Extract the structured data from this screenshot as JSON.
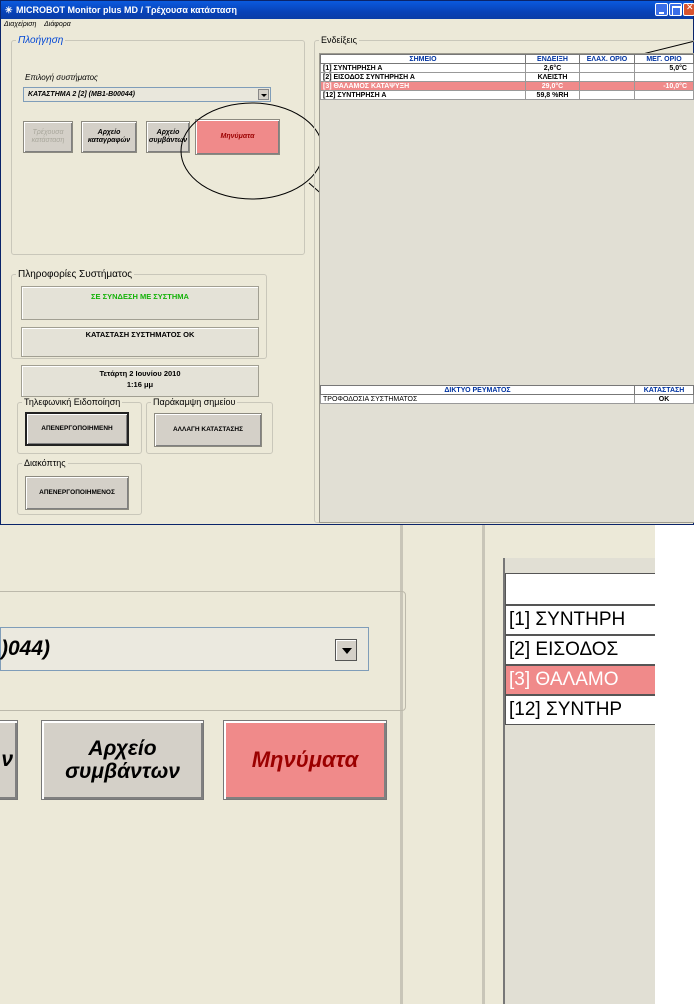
{
  "window": {
    "title": "MICROBOT Monitor plus MD / Τρέχουσα κατάσταση",
    "menu": [
      "Διαχείριση",
      "Διάφορα"
    ]
  },
  "navigation": {
    "legend": "Πλοήγηση",
    "system_label": "Επιλογή συστήματος",
    "system_value": "ΚΑΤΑΣΤΗΜΑ 2 [2] (MB1-B00044)",
    "btn_current": "Τρέχουσα κατάσταση",
    "btn_log": "Αρχείο καταγραφών",
    "btn_events": "Αρχείο συμβάντων",
    "btn_messages": "Μηνύματα"
  },
  "system_info": {
    "legend": "Πληροφορίες Συστήματος",
    "connection": "ΣΕ ΣΥΝΔΕΣΗ ΜΕ ΣΥΣΤΗΜΑ",
    "status": "ΚΑΤΑΣΤΑΣΗ ΣΥΣΤΗΜΑΤΟΣ ΟΚ",
    "date": "Τετάρτη 2 Ιουνίου 2010",
    "time": "1:16 μμ"
  },
  "phone": {
    "legend": "Τηλεφωνική Ειδοποίηση",
    "button": "ΑΠΕΝΕΡΓΟΠΟΙΗΜΕΝΗ"
  },
  "override": {
    "legend": "Παράκαμψη σημείου",
    "button": "ΑΛΛΑΓΗ ΚΑΤΑΣΤΑΣΗΣ"
  },
  "switch": {
    "legend": "Διακόπτης",
    "button": "ΑΠΕΝΕΡΓΟΠΟΙΗΜΕΝΟΣ"
  },
  "indications": {
    "legend": "Ενδείξεις",
    "headers": [
      "ΣΗΜΕΙΟ",
      "ΕΝΔΕΙΞΗ",
      "ΕΛΑΧ. ΟΡΙΟ",
      "ΜΕΓ. ΟΡΙΟ"
    ],
    "rows": [
      {
        "point": "[1] ΣΥΝΤΗΡΗΣΗ Α",
        "value": "2,6°C",
        "min": "",
        "max": "5,0°C",
        "alarm": false
      },
      {
        "point": "[2] ΕΙΣΟΔΟΣ ΣΥΝΤΗΡΗΣΗ Α",
        "value": "ΚΛΕΙΣΤΗ",
        "min": "",
        "max": "",
        "alarm": false
      },
      {
        "point": "[3] ΘΑΛΑΜΟΣ ΚΑΤΑΨΥΞΗ",
        "value": "29,0°C",
        "min": "",
        "max": "-10,0°C",
        "alarm": true
      },
      {
        "point": "[12] ΣΥΝΤΗΡΗΣΗ Α",
        "value": "59,8 %RH",
        "min": "",
        "max": "",
        "alarm": false
      }
    ]
  },
  "power": {
    "headers": [
      "ΔΙΚΤΥΟ ΡΕΥΜΑΤΟΣ",
      "ΚΑΤΑΣΤΑΣΗ"
    ],
    "rows": [
      {
        "name": "ΤΡΟΦΟΔΟΣΙΑ ΣΥΣΤΗΜΑΤΟΣ",
        "state": "ΟΚ"
      }
    ]
  },
  "zoom": {
    "combo_text": ")044)",
    "btn_partial": "ν",
    "btn_events_line1": "Αρχείο",
    "btn_events_line2": "συμβάντων",
    "btn_messages": "Μηνύματα",
    "rows": [
      "[1] ΣΥΝΤΗΡΗ",
      "[2] ΕΙΣΟΔΟΣ",
      "[3] ΘΑΛΑΜΟ",
      "[12] ΣΥΝΤΗΡ"
    ]
  },
  "colors": {
    "alarm": "#f08a8a",
    "title_bar": "#0842b8",
    "header_text": "#0033a0",
    "online": "#15b20a"
  }
}
